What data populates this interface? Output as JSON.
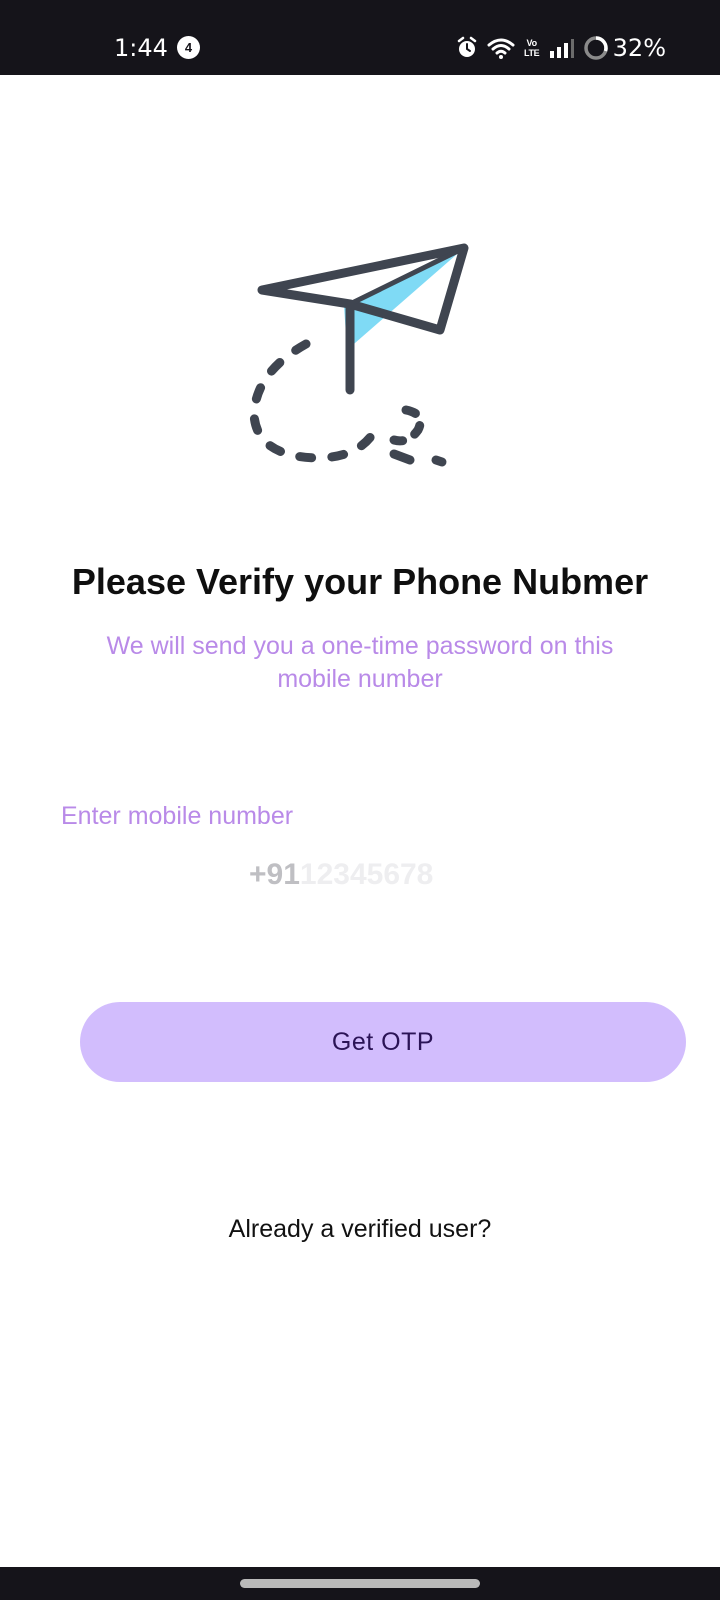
{
  "status_bar": {
    "time": "1:44",
    "notification_count": "4",
    "network_label": "Vo LTE",
    "battery": "32%"
  },
  "illustration": {
    "icon": "paper-plane-icon",
    "colors": {
      "stroke": "#3f4550",
      "accent": "#7fdaf5"
    }
  },
  "main": {
    "title": "Please Verify your Phone Nubmer",
    "subtitle": "We will send you a one-time password on this mobile number"
  },
  "phone": {
    "label": "Enter mobile number",
    "country_code": "+91",
    "placeholder": "12345678",
    "value": ""
  },
  "actions": {
    "get_otp_label": "Get OTP",
    "verified_link": "Already a verified user?"
  },
  "colors": {
    "accent_text": "#b98ae8",
    "button_bg": "#d2bdfd",
    "button_text": "#2b1456",
    "system_bar": "#15141a"
  }
}
